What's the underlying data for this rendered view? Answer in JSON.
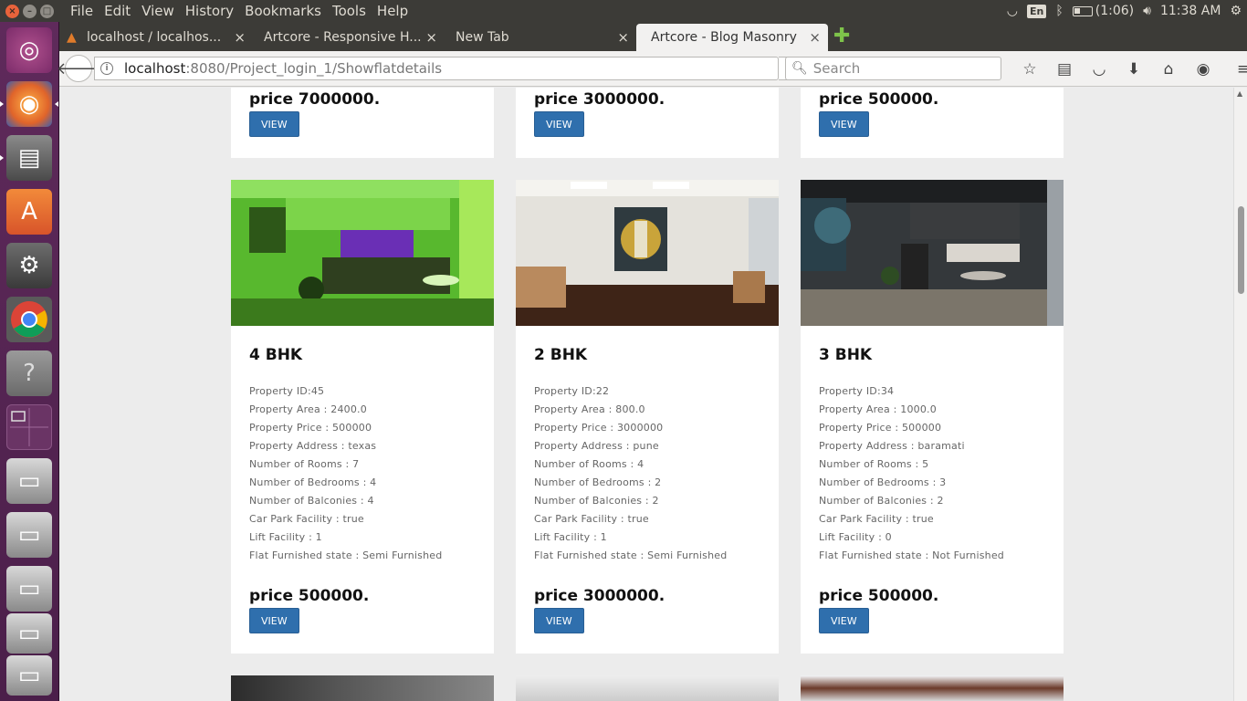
{
  "menubar": {
    "items": [
      "File",
      "Edit",
      "View",
      "History",
      "Bookmarks",
      "Tools",
      "Help"
    ],
    "tray": {
      "lang": "En",
      "battery": "(1:06)",
      "time": "11:38 AM"
    }
  },
  "tabs": [
    {
      "label": "localhost / localhos...",
      "active": false
    },
    {
      "label": "Artcore - Responsive H...",
      "active": false
    },
    {
      "label": "New Tab",
      "active": false
    },
    {
      "label": "Artcore - Blog Masonry",
      "active": true
    }
  ],
  "navbar": {
    "url_host": "localhost",
    "url_rest": ":8080/Project_login_1/Showflatdetails",
    "search_placeholder": "Search"
  },
  "top_prices": [
    {
      "price": "price 7000000.",
      "button": "VIEW"
    },
    {
      "price": "price 3000000.",
      "button": "VIEW"
    },
    {
      "price": "price 500000.",
      "button": "VIEW"
    }
  ],
  "listings": [
    {
      "title": "4 BHK",
      "lines": [
        "Property ID:45",
        "Property Area : 2400.0",
        "Property Price : 500000",
        "Property Address : texas",
        "Number of Rooms : 7",
        "Number of Bedrooms : 4",
        "Number of Balconies : 4",
        "Car Park Facility : true",
        "Lift Facility : 1",
        "Flat Furnished state : Semi Furnished"
      ],
      "price": "price 500000.",
      "button": "VIEW"
    },
    {
      "title": "2 BHK",
      "lines": [
        "Property ID:22",
        "Property Area : 800.0",
        "Property Price : 3000000",
        "Property Address : pune",
        "Number of Rooms : 4",
        "Number of Bedrooms : 2",
        "Number of Balconies : 2",
        "Car Park Facility : true",
        "Lift Facility : 1",
        "Flat Furnished state : Semi Furnished"
      ],
      "price": "price 3000000.",
      "button": "VIEW"
    },
    {
      "title": "3 BHK",
      "lines": [
        "Property ID:34",
        "Property Area : 1000.0",
        "Property Price : 500000",
        "Property Address : baramati",
        "Number of Rooms : 5",
        "Number of Bedrooms : 3",
        "Number of Balconies : 2",
        "Car Park Facility : true",
        "Lift Facility : 0",
        "Flat Furnished state : Not Furnished"
      ],
      "price": "price 500000.",
      "button": "VIEW"
    }
  ]
}
